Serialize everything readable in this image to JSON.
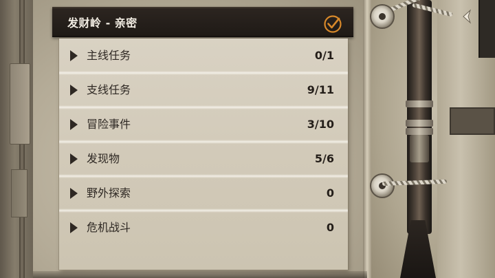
{
  "header": {
    "title": "发财岭 - 亲密",
    "complete_icon": "check-circle-icon"
  },
  "categories": [
    {
      "label": "主线任务",
      "count": "0/1"
    },
    {
      "label": "支线任务",
      "count": "9/11"
    },
    {
      "label": "冒险事件",
      "count": "3/10"
    },
    {
      "label": "发现物",
      "count": "5/6"
    },
    {
      "label": "野外探索",
      "count": "0"
    },
    {
      "label": "危机战斗",
      "count": "0"
    }
  ],
  "navigation": {
    "back_icon": "back-arrow-icon"
  },
  "colors": {
    "header_bg": "#231d19",
    "header_text": "#f1ece2",
    "accent_orange": "#d8892a",
    "paper": "#d4ccbb",
    "ink": "#2e2823"
  }
}
